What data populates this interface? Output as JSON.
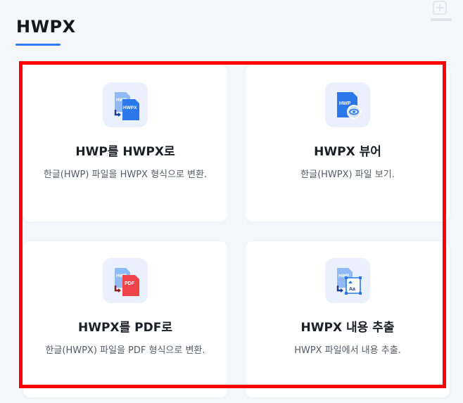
{
  "section": {
    "title": "HWPX"
  },
  "colors": {
    "accent": "#2f7cf6",
    "highlight": "#ff0000",
    "icon_tile_bg": "#eaf0fd",
    "pdf_red": "#f0444b",
    "hwp_light_blue": "#7fb3f7",
    "hwp_blue": "#2a78ea"
  },
  "cards": [
    {
      "icon": "hwp-to-hwpx-icon",
      "title": "HWP를 HWPX로",
      "desc": "한글(HWP) 파일을 HWPX 형식으로 변환."
    },
    {
      "icon": "hwpx-viewer-icon",
      "title": "HWPX 뷰어",
      "desc": "한글(HWPX) 파일 보기."
    },
    {
      "icon": "hwpx-to-pdf-icon",
      "title": "HWPX를 PDF로",
      "desc": "한글(HWPX) 파일을 PDF 형식으로 변환."
    },
    {
      "icon": "hwpx-extract-icon",
      "title": "HWPX 내용 추출",
      "desc": "HWPX 파일에서 내용 추출."
    }
  ],
  "icon_text": {
    "hwp": "HWP",
    "hwpx": "HWPX",
    "pdf": "PDF",
    "aa": "Aa"
  }
}
